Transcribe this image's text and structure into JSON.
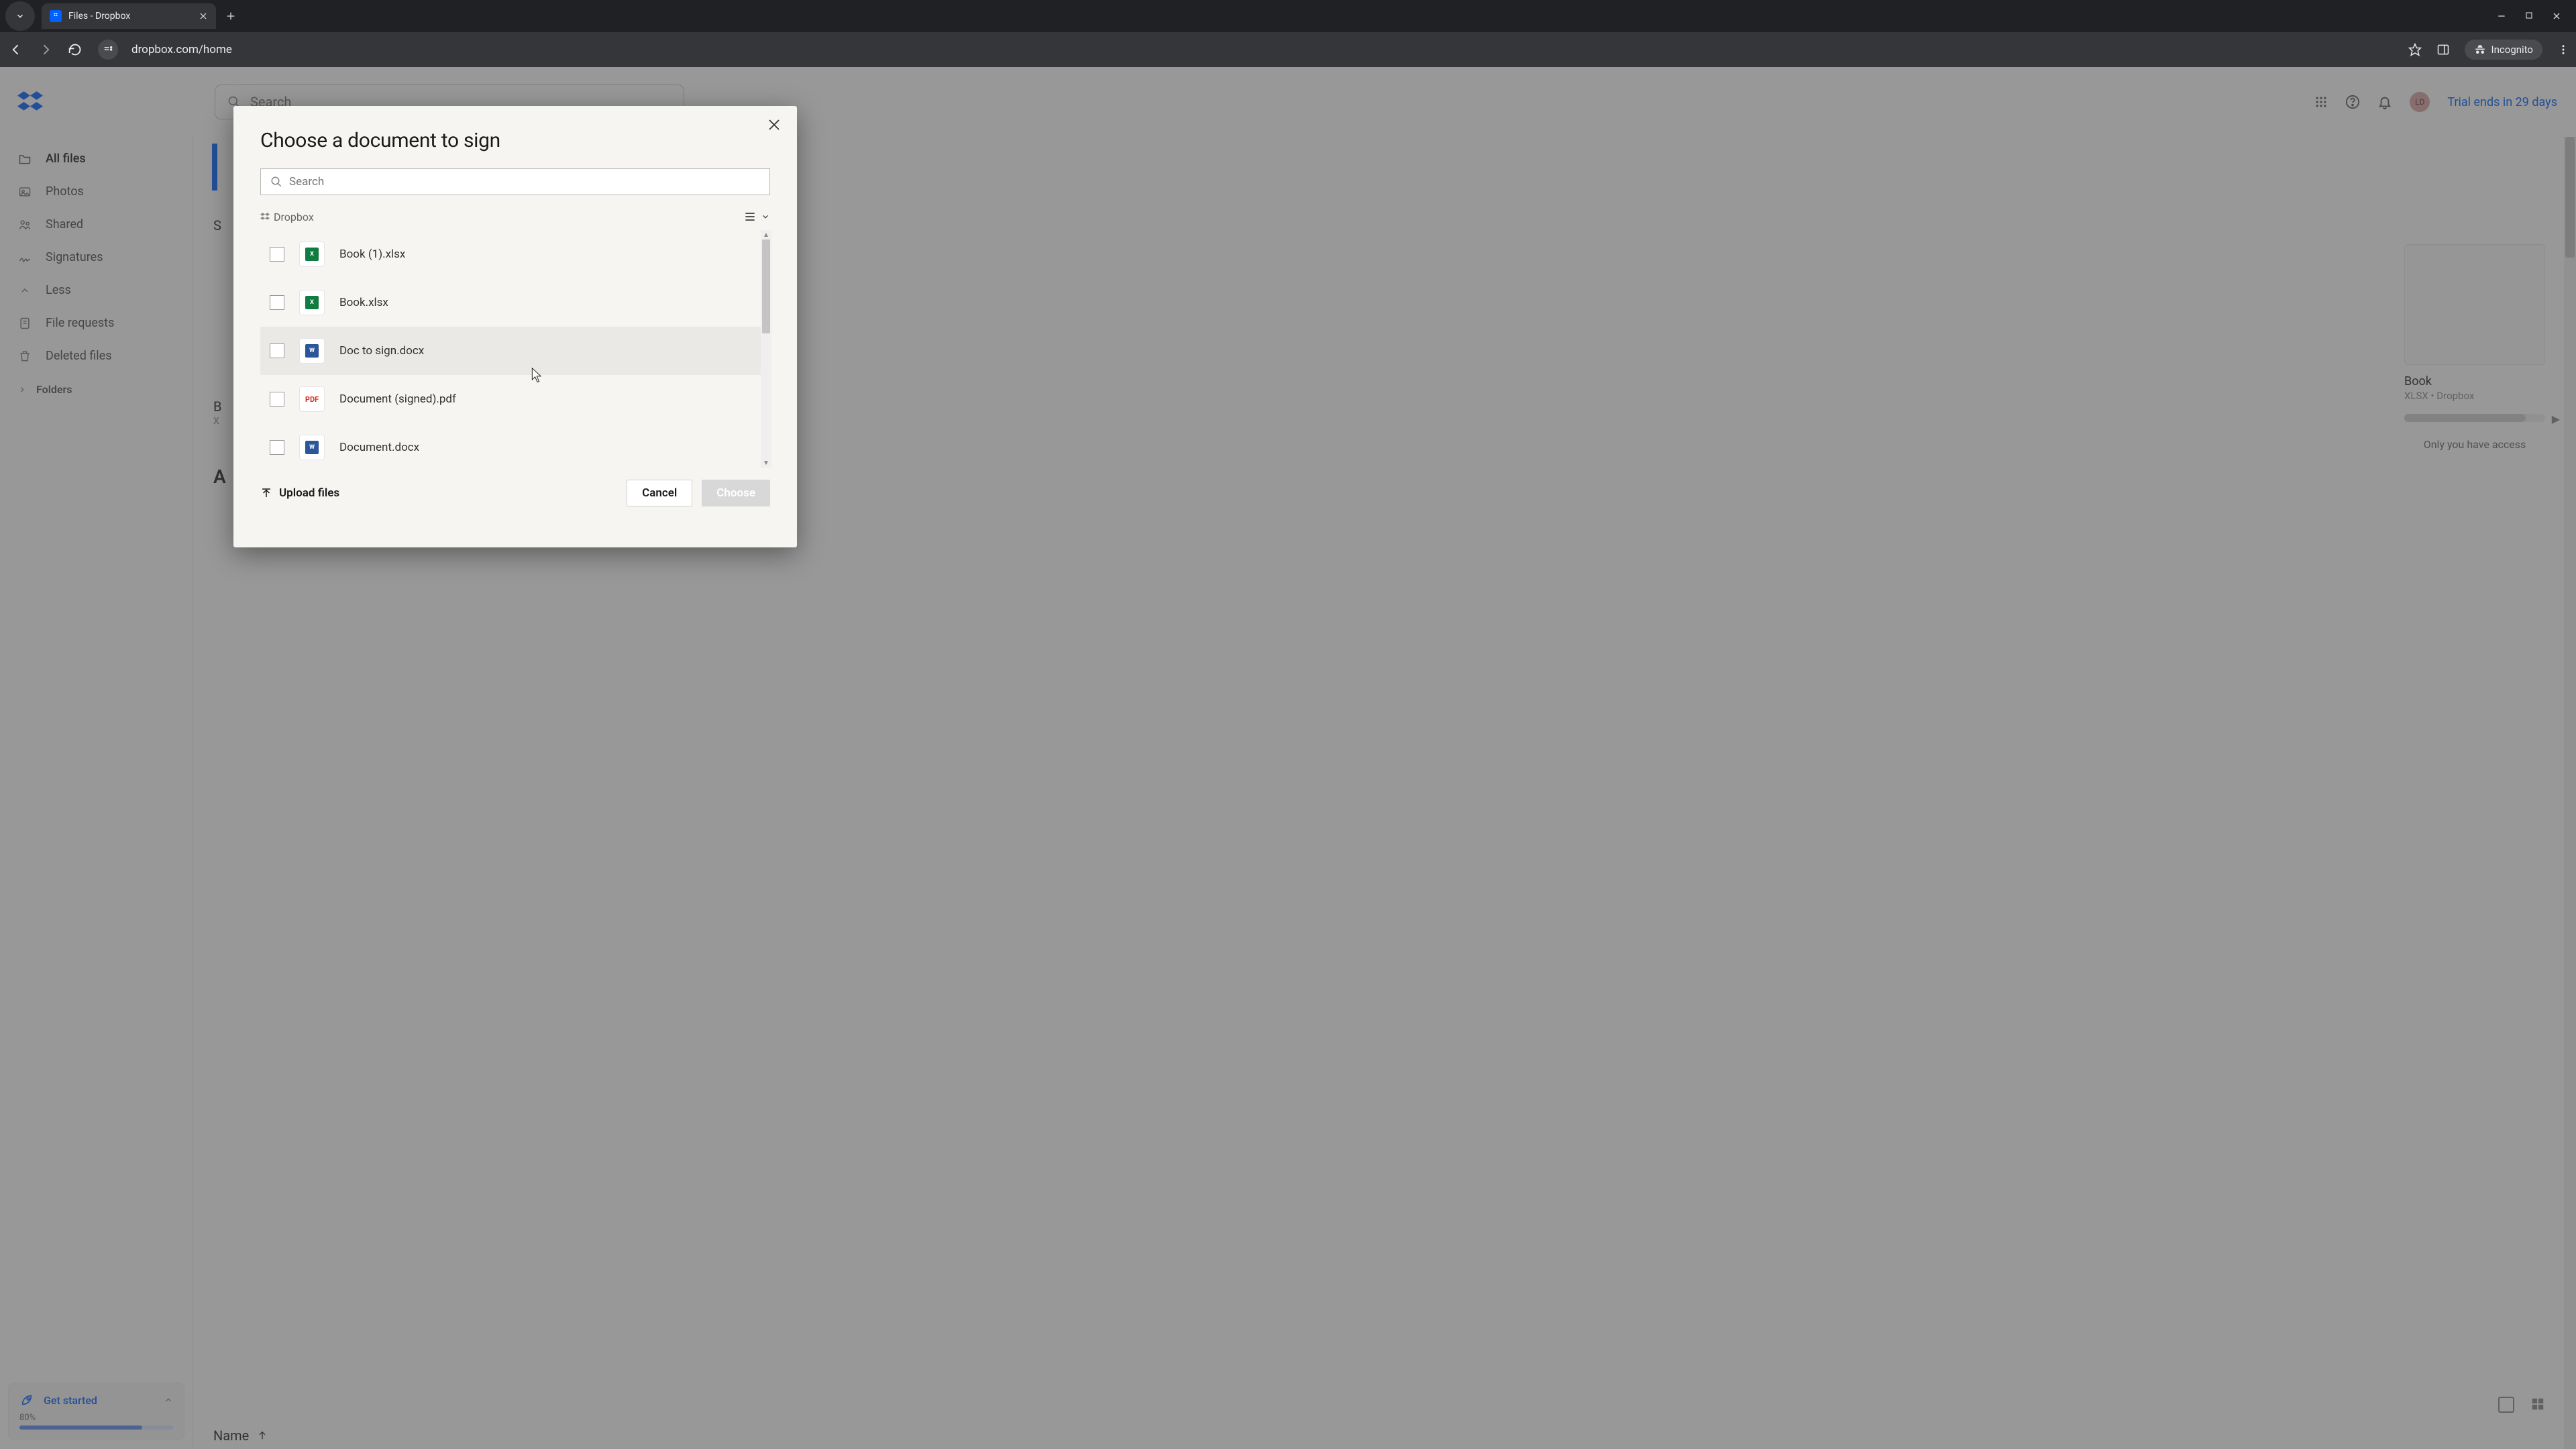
{
  "browser": {
    "tab_title": "Files - Dropbox",
    "url": "dropbox.com/home",
    "incognito_label": "Incognito"
  },
  "header": {
    "search_placeholder": "Search",
    "avatar_initials": "LD",
    "trial_text": "Trial ends in 29 days"
  },
  "sidebar": {
    "items": {
      "all_files": "All files",
      "photos": "Photos",
      "shared": "Shared",
      "signatures": "Signatures",
      "less": "Less",
      "file_requests": "File requests",
      "deleted_files": "Deleted files"
    },
    "folders_label": "Folders"
  },
  "get_started": {
    "title": "Get started",
    "percent": "80%"
  },
  "main": {
    "card_name": "Book",
    "card_sub": "XLSX • Dropbox",
    "only_you": "Only you have access",
    "name_header": "Name"
  },
  "modal": {
    "title": "Choose a document to sign",
    "search_placeholder": "Search",
    "breadcrumb": "Dropbox",
    "files": [
      {
        "name": "Book (1).xlsx",
        "type": "xlsx"
      },
      {
        "name": "Book.xlsx",
        "type": "xlsx"
      },
      {
        "name": "Doc to sign.docx",
        "type": "docx"
      },
      {
        "name": "Document (signed).pdf",
        "type": "pdf"
      },
      {
        "name": "Document.docx",
        "type": "docx"
      }
    ],
    "upload_label": "Upload files",
    "cancel_label": "Cancel",
    "choose_label": "Choose"
  }
}
